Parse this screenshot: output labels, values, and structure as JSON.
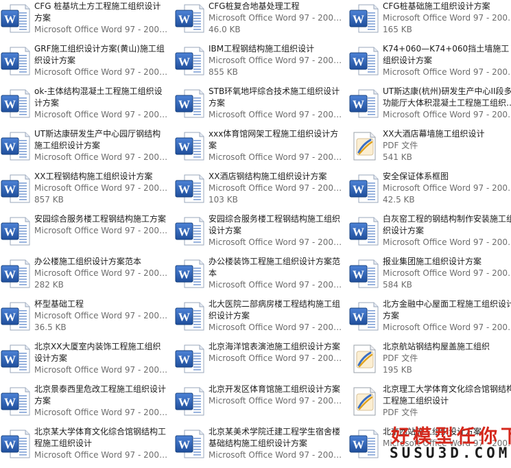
{
  "files": [
    {
      "name": "CFG 桩基坑土方工程施工组织设计方案",
      "type": "Microsoft Office Word 97 - 2003 文档",
      "size": "",
      "icon": "word-icon"
    },
    {
      "name": "CFG桩复合地基处理工程",
      "type": "Microsoft Office Word 97 - 2003 文档",
      "size": "46.0 KB",
      "icon": "word-icon"
    },
    {
      "name": "CFG桩基础施工组织设计方案",
      "type": "Microsoft Office Word 97 - 2003 文档",
      "size": "165 KB",
      "icon": "word-icon"
    },
    {
      "name": "GRF施工组织设计方案(黄山)施工组织设计方案",
      "type": "Microsoft Office Word 97 - 2003 文档",
      "size": "",
      "icon": "word-icon"
    },
    {
      "name": "IBM工程钢结构施工组织设计",
      "type": "Microsoft Office Word 97 - 2003 文档",
      "size": "855 KB",
      "icon": "word-icon"
    },
    {
      "name": "K74+060—K74+060挡土墙施工组织设计方案",
      "type": "Microsoft Office Word 97 - 2003 文档",
      "size": "",
      "icon": "word-icon"
    },
    {
      "name": "ok-主体结构混凝土工程施工组织设计方案",
      "type": "Microsoft Office Word 97 - 2003 文档",
      "size": "",
      "icon": "word-icon"
    },
    {
      "name": "STB环氧地坪综合技术施工组织设计方案",
      "type": "Microsoft Office Word 97 - 2003 文档",
      "size": "",
      "icon": "word-icon"
    },
    {
      "name": "UT斯达康(杭州)研发生产中心II段多功能厅大体积混凝土工程施工组织设计方案",
      "type": "Microsoft Office Word 97 - 2003 文档",
      "size": "",
      "icon": "word-icon"
    },
    {
      "name": "UT斯达康研发生产中心园厅钢结构施工组织设计方案",
      "type": "Microsoft Office Word 97 - 2003 文档",
      "size": "",
      "icon": "word-icon"
    },
    {
      "name": "xxx体育馆网架工程施工组织设计方案",
      "type": "Microsoft Office Word 97 - 2003 文档",
      "size": "",
      "icon": "word-icon"
    },
    {
      "name": "XX大酒店幕墙施工组织设计",
      "type": "PDF 文件",
      "size": "541 KB",
      "icon": "pdf-icon"
    },
    {
      "name": "XX工程钢结构施工组织设计方案",
      "type": "Microsoft Office Word 97 - 2003 文档",
      "size": "857 KB",
      "icon": "word-icon"
    },
    {
      "name": "XX酒店钢结构施工组织设计方案",
      "type": "Microsoft Office Word 97 - 2003 文档",
      "size": "103 KB",
      "icon": "word-icon"
    },
    {
      "name": "安全保证体系框图",
      "type": "Microsoft Office Word 97 - 2003 文档",
      "size": "42.5 KB",
      "icon": "word-icon"
    },
    {
      "name": "安园综合服务楼工程钢结构施工方案",
      "type": "Microsoft Office Word 97 - 2003 文档",
      "size": "",
      "icon": "word-icon"
    },
    {
      "name": "安园综合服务楼工程钢结构施工组织设计方案",
      "type": "Microsoft Office Word 97 - 2003 文档",
      "size": "",
      "icon": "word-icon"
    },
    {
      "name": "白灰窑工程的钢结构制作安装施工组织设计方案",
      "type": "Microsoft Office Word 97 - 2003 文档",
      "size": "",
      "icon": "word-icon"
    },
    {
      "name": "办公楼施工组织设计方案范本",
      "type": "Microsoft Office Word 97 - 2003 文档",
      "size": "282 KB",
      "icon": "word-icon"
    },
    {
      "name": "办公楼装饰工程施工组织设计方案范本",
      "type": "Microsoft Office Word 97 - 2003 文档",
      "size": "",
      "icon": "word-icon"
    },
    {
      "name": "报业集团施工组织设计方案",
      "type": "Microsoft Office Word 97 - 2003 文档",
      "size": "584 KB",
      "icon": "word-icon"
    },
    {
      "name": "杯型基础工程",
      "type": "Microsoft Office Word 97 - 2003 文档",
      "size": "36.5 KB",
      "icon": "word-icon"
    },
    {
      "name": "北大医院二部病房楼工程结构施工组织设计方案",
      "type": "Microsoft Office Word 97 - 2003 文档",
      "size": "",
      "icon": "word-icon"
    },
    {
      "name": "北方金融中心屋面工程施工组织设计方案",
      "type": "Microsoft Office Word 97 - 2003 文档",
      "size": "",
      "icon": "word-icon"
    },
    {
      "name": "北京XX大厦室内装饰工程施工组织设计方案",
      "type": "Microsoft Office Word 97 - 2003 文档",
      "size": "",
      "icon": "word-icon"
    },
    {
      "name": "北京海洋馆表演池施工组织设计方案",
      "type": "Microsoft Office Word 97 - 2003 文档",
      "size": "",
      "icon": "word-icon"
    },
    {
      "name": "北京航站钢结构屋盖施工组织",
      "type": "PDF 文件",
      "size": "195 KB",
      "icon": "pdf-icon"
    },
    {
      "name": "北京景泰西里危改工程施工组织设计方案",
      "type": "Microsoft Office Word 97 - 2003 文档",
      "size": "",
      "icon": "word-icon"
    },
    {
      "name": "北京开发区体育馆施工组织设计方案",
      "type": "Microsoft Office Word 97 - 2003 文档",
      "size": "",
      "icon": "word-icon"
    },
    {
      "name": "北京理工大学体育文化综合馆钢结构工程施工组织设计",
      "type": "PDF 文件",
      "size": "",
      "icon": "pdf-icon"
    },
    {
      "name": "北京某大学体育文化综合馆钢结构工程施工组织设计",
      "type": "Microsoft Office Word 97 - 2003 文档",
      "size": "",
      "icon": "word-icon"
    },
    {
      "name": "北京某美术学院迁建工程学生宿舍楼基础结构施工组织设计方案",
      "type": "Microsoft Office Word 97 - 2003 文档",
      "size": "",
      "icon": "word-icon"
    },
    {
      "name": "北京西站施工组织设计方案",
      "type": "Microsoft Office Word 97 - 2003 文档",
      "size": "",
      "icon": "word-icon"
    }
  ],
  "watermark": {
    "line1": "好模型任你下",
    "line2": "SUSU3D.COM"
  },
  "colors": {
    "word_blue": "#2a5ab0",
    "pdf_red": "#c8312b",
    "type_gray": "#6d6d6d",
    "watermark_red": "#d5281c"
  }
}
